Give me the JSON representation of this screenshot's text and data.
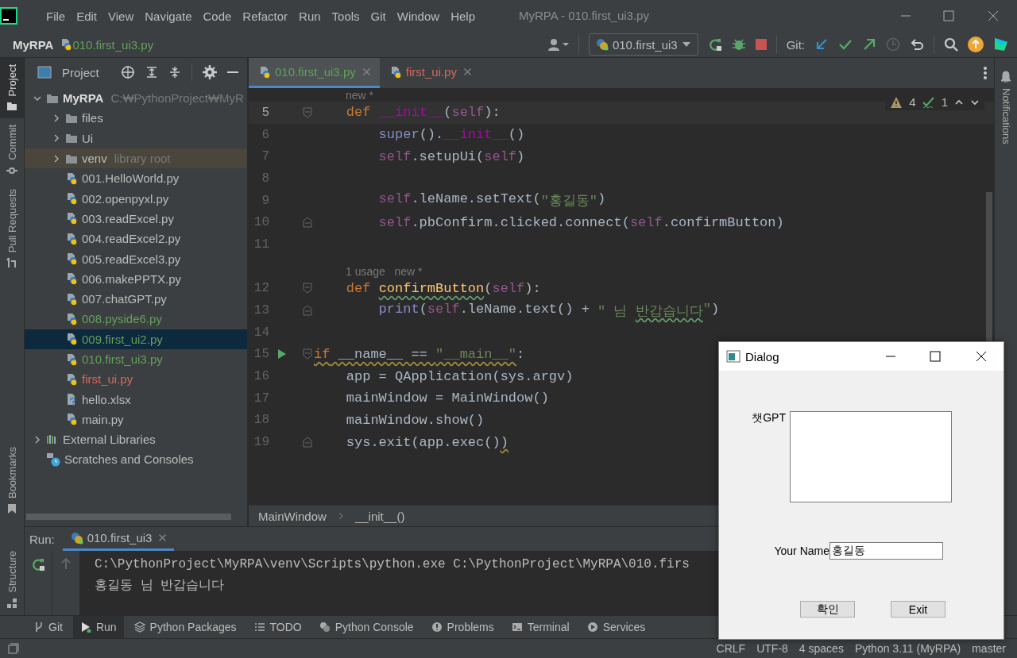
{
  "window": {
    "title": "MyRPA - 010.first_ui3.py"
  },
  "menu": [
    "File",
    "Edit",
    "View",
    "Navigate",
    "Code",
    "Refactor",
    "Run",
    "Tools",
    "Git",
    "Window",
    "Help"
  ],
  "breadcrumb": {
    "project": "MyRPA",
    "file": "010.first_ui3.py"
  },
  "toolbar": {
    "run_config": "010.first_ui3",
    "git_label": "Git:"
  },
  "left_strip": {
    "top": [
      {
        "label": "Project",
        "selected": true
      },
      {
        "label": "Commit",
        "selected": false
      },
      {
        "label": "Pull Requests",
        "selected": false
      }
    ],
    "bottom": [
      {
        "label": "Bookmarks",
        "selected": false
      },
      {
        "label": "Structure",
        "selected": false
      }
    ]
  },
  "right_strip": {
    "label": "Notifications"
  },
  "project_panel": {
    "title": "Project",
    "tree": [
      {
        "label": "MyRPA",
        "hint": "C:₩PythonProject₩MyR",
        "kind": "folder",
        "expanded": true,
        "selected": false,
        "children": [
          {
            "label": "files",
            "kind": "folder",
            "expanded": false,
            "selected": false
          },
          {
            "label": "Ui",
            "kind": "folder",
            "expanded": false,
            "selected": false
          },
          {
            "label": "venv",
            "hint": "library root",
            "kind": "library_root",
            "expanded": false,
            "selected": false
          },
          {
            "label": "001.HelloWorld.py",
            "kind": "python",
            "color": "#bbbbbb",
            "selected": false
          },
          {
            "label": "002.openpyxl.py",
            "kind": "python",
            "color": "#bbbbbb",
            "selected": false
          },
          {
            "label": "003.readExcel.py",
            "kind": "python",
            "color": "#bbbbbb",
            "selected": false
          },
          {
            "label": "004.readExcel2.py",
            "kind": "python",
            "color": "#bbbbbb",
            "selected": false
          },
          {
            "label": "005.readExcel3.py",
            "kind": "python",
            "color": "#bbbbbb",
            "selected": false
          },
          {
            "label": "006.makePPTX.py",
            "kind": "python",
            "color": "#bbbbbb",
            "selected": false
          },
          {
            "label": "007.chatGPT.py",
            "kind": "python",
            "color": "#bbbbbb",
            "selected": false
          },
          {
            "label": "008.pyside6.py",
            "kind": "python",
            "color": "#62a05a",
            "selected": false
          },
          {
            "label": "009.first_ui2.py",
            "kind": "python",
            "color": "#62a05a",
            "selected": true
          },
          {
            "label": "010.first_ui3.py",
            "kind": "python",
            "color": "#62a05a",
            "selected": false
          },
          {
            "label": "first_ui.py",
            "kind": "python",
            "color": "#d5695b",
            "selected": false
          },
          {
            "label": "hello.xlsx",
            "kind": "unknown",
            "color": "#bbbbbb",
            "selected": false
          },
          {
            "label": "main.py",
            "kind": "python",
            "color": "#bbbbbb",
            "selected": false
          }
        ]
      },
      {
        "label": "External Libraries",
        "kind": "libraries",
        "expanded": false,
        "selected": false
      },
      {
        "label": "Scratches and Consoles",
        "kind": "scratches",
        "selected": false
      }
    ]
  },
  "editor": {
    "tabs": [
      {
        "label": "010.first_ui3.py",
        "color": "#62a05a",
        "selected": true
      },
      {
        "label": "first_ui.py",
        "color": "#d5695b",
        "selected": false
      }
    ],
    "inspections": {
      "warnings": "4",
      "typos": "1"
    },
    "lines": [
      {
        "kind": "hint",
        "text": "new *"
      },
      {
        "kind": "code",
        "number": "5",
        "current": true,
        "fold_start": true,
        "fold_end": false,
        "tokens": [
          {
            "text": "    def ",
            "kind": "keyword"
          },
          {
            "text": "__init__",
            "kind": "magic"
          },
          {
            "text": "(",
            "kind": "plain"
          },
          {
            "text": "self",
            "kind": "self"
          },
          {
            "text": "):",
            "kind": "plain"
          }
        ]
      },
      {
        "kind": "code",
        "number": "6",
        "current": false,
        "fold_start": false,
        "fold_end": false,
        "tokens": [
          {
            "text": "        super",
            "kind": "builtin"
          },
          {
            "text": "().",
            "kind": "plain"
          },
          {
            "text": "__init__",
            "kind": "magic"
          },
          {
            "text": "()",
            "kind": "plain"
          }
        ]
      },
      {
        "kind": "code",
        "number": "7",
        "current": false,
        "fold_start": false,
        "fold_end": false,
        "tokens": [
          {
            "text": "        self",
            "kind": "self"
          },
          {
            "text": ".setupUi(",
            "kind": "plain"
          },
          {
            "text": "self",
            "kind": "self"
          },
          {
            "text": ")",
            "kind": "plain"
          }
        ]
      },
      {
        "kind": "code",
        "number": "8",
        "current": false,
        "fold_start": false,
        "fold_end": false
      },
      {
        "kind": "code",
        "number": "9",
        "current": false,
        "fold_start": false,
        "fold_end": false,
        "tokens": [
          {
            "text": "        self",
            "kind": "self"
          },
          {
            "text": ".leName.setText(",
            "kind": "plain"
          },
          {
            "text": "\"홍길동\"",
            "kind": "string"
          },
          {
            "text": ")",
            "kind": "plain"
          }
        ]
      },
      {
        "kind": "code",
        "number": "10",
        "current": false,
        "fold_start": false,
        "fold_end": true,
        "tokens": [
          {
            "text": "        self",
            "kind": "self"
          },
          {
            "text": ".pbConfirm.clicked.connect(",
            "kind": "plain"
          },
          {
            "text": "self",
            "kind": "self"
          },
          {
            "text": ".confirmButton)",
            "kind": "plain"
          }
        ]
      },
      {
        "kind": "code",
        "number": "11",
        "current": false,
        "fold_start": false,
        "fold_end": false
      },
      {
        "kind": "hint",
        "text": "1 usage   new *"
      },
      {
        "kind": "code",
        "number": "12",
        "current": false,
        "fold_start": true,
        "fold_end": false,
        "tokens": [
          {
            "text": "    def ",
            "kind": "keyword"
          },
          {
            "text": "confirmButton",
            "kind": "function",
            "typo": true
          },
          {
            "text": "(",
            "kind": "plain"
          },
          {
            "text": "self",
            "kind": "self"
          },
          {
            "text": "):",
            "kind": "plain"
          }
        ]
      },
      {
        "kind": "code",
        "number": "13",
        "current": false,
        "fold_start": false,
        "fold_end": true,
        "tokens": [
          {
            "text": "        print",
            "kind": "builtin"
          },
          {
            "text": "(",
            "kind": "plain"
          },
          {
            "text": "self",
            "kind": "self"
          },
          {
            "text": ".leName.text() + ",
            "kind": "plain"
          },
          {
            "text": "\" 님 ",
            "kind": "string"
          },
          {
            "text": "반갑습니다",
            "kind": "string",
            "typo": true
          },
          {
            "text": "\"",
            "kind": "string"
          },
          {
            "text": ")",
            "kind": "plain"
          }
        ]
      },
      {
        "kind": "code",
        "number": "14",
        "current": false,
        "fold_start": false,
        "fold_end": false
      },
      {
        "kind": "code",
        "number": "15",
        "current": false,
        "runnable": true,
        "fold_start": true,
        "fold_end": false,
        "tokens": [
          {
            "text": "if",
            "kind": "keyword",
            "warning": true
          },
          {
            "text": " __name__ == ",
            "kind": "plain",
            "warning": true
          },
          {
            "text": "\"__main__\"",
            "kind": "string",
            "warning": true
          },
          {
            "text": ":",
            "kind": "plain"
          }
        ]
      },
      {
        "kind": "code",
        "number": "16",
        "current": false,
        "fold_start": false,
        "fold_end": false,
        "tokens": [
          {
            "text": "    app = QApplication(sys.argv)",
            "kind": "plain"
          }
        ]
      },
      {
        "kind": "code",
        "number": "17",
        "current": false,
        "fold_start": false,
        "fold_end": false,
        "tokens": [
          {
            "text": "    mainWindow = MainWindow()",
            "kind": "plain"
          }
        ]
      },
      {
        "kind": "code",
        "number": "18",
        "current": false,
        "fold_start": false,
        "fold_end": false,
        "tokens": [
          {
            "text": "    mainWindow.show()",
            "kind": "plain"
          }
        ]
      },
      {
        "kind": "code",
        "number": "19",
        "current": false,
        "fold_start": false,
        "fold_end": true,
        "tokens": [
          {
            "text": "    sys.exit(app.exec()",
            "kind": "plain"
          },
          {
            "text": ")",
            "kind": "plain",
            "warning": true
          }
        ]
      }
    ],
    "breadcrumb": [
      "MainWindow",
      "__init__()"
    ]
  },
  "run_panel": {
    "label": "Run:",
    "tab": "010.first_ui3",
    "console": [
      "C:\\PythonProject\\MyRPA\\venv\\Scripts\\python.exe C:\\PythonProject\\MyRPA\\010.firs",
      "홍길동 님 반갑습니다"
    ]
  },
  "tool_windows": [
    {
      "label": "Git",
      "selected": false
    },
    {
      "label": "Run",
      "selected": true
    },
    {
      "label": "Python Packages",
      "selected": false
    },
    {
      "label": "TODO",
      "selected": false
    },
    {
      "label": "Python Console",
      "selected": false
    },
    {
      "label": "Problems",
      "selected": false
    },
    {
      "label": "Terminal",
      "selected": false
    },
    {
      "label": "Services",
      "selected": false
    }
  ],
  "status_bar": [
    "CRLF",
    "UTF-8",
    "4 spaces",
    "Python 3.11 (MyRPA)",
    "master"
  ],
  "dialog": {
    "title": "Dialog",
    "chat_label": "챗GPT",
    "name_label": "Your Name",
    "name_value": "홍길동",
    "buttons": [
      "확인",
      "Exit"
    ]
  }
}
